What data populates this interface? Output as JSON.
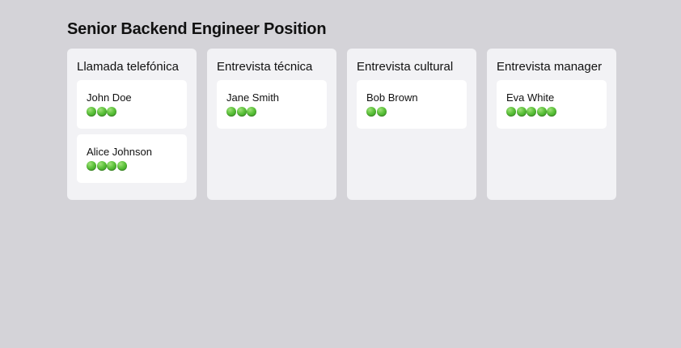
{
  "page": {
    "title": "Senior Backend Engineer Position"
  },
  "columns": [
    {
      "title": "Llamada telefónica",
      "cards": [
        {
          "name": "John Doe",
          "rating": 3
        },
        {
          "name": "Alice Johnson",
          "rating": 4
        }
      ]
    },
    {
      "title": "Entrevista técnica",
      "cards": [
        {
          "name": "Jane Smith",
          "rating": 3
        }
      ]
    },
    {
      "title": "Entrevista cultural",
      "cards": [
        {
          "name": "Bob Brown",
          "rating": 2
        }
      ]
    },
    {
      "title": "Entrevista manager",
      "cards": [
        {
          "name": "Eva White",
          "rating": 5
        }
      ]
    }
  ],
  "colors": {
    "background": "#d4d3d8",
    "column": "#f2f2f5",
    "card": "#ffffff",
    "rating_dot": "#4caf2e"
  }
}
